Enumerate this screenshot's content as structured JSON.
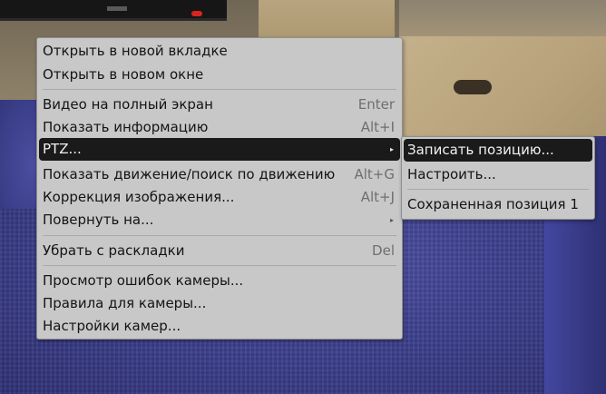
{
  "context_menu": {
    "items": [
      {
        "label": "Открыть в новой вкладке",
        "shortcut": ""
      },
      {
        "label": "Открыть в новом окне",
        "shortcut": ""
      },
      {
        "label": "Видео на полный экран",
        "shortcut": "Enter"
      },
      {
        "label": "Показать информацию",
        "shortcut": "Alt+I"
      },
      {
        "label": "PTZ...",
        "shortcut": "",
        "submenu_arrow": "▸",
        "selected": true
      },
      {
        "label": "Показать движение/поиск по движению",
        "shortcut": "Alt+G"
      },
      {
        "label": "Коррекция изображения...",
        "shortcut": "Alt+J"
      },
      {
        "label": "Повернуть на...",
        "shortcut": "",
        "submenu_arrow": "▸"
      },
      {
        "label": "Убрать с раскладки",
        "shortcut": "Del"
      },
      {
        "label": "Просмотр ошибок камеры...",
        "shortcut": ""
      },
      {
        "label": "Правила для камеры...",
        "shortcut": ""
      },
      {
        "label": "Настройки камер...",
        "shortcut": ""
      }
    ]
  },
  "ptz_submenu": {
    "items": [
      {
        "label": "Записать позицию...",
        "selected": true
      },
      {
        "label": "Настроить..."
      },
      {
        "label": "Сохраненная позиция 1"
      }
    ]
  },
  "colors": {
    "menu_bg": "#c8c8c8",
    "highlight_bg": "#1a1a1a",
    "highlight_text": "#f2f2f2",
    "shortcut_text": "#6f6f6f"
  }
}
